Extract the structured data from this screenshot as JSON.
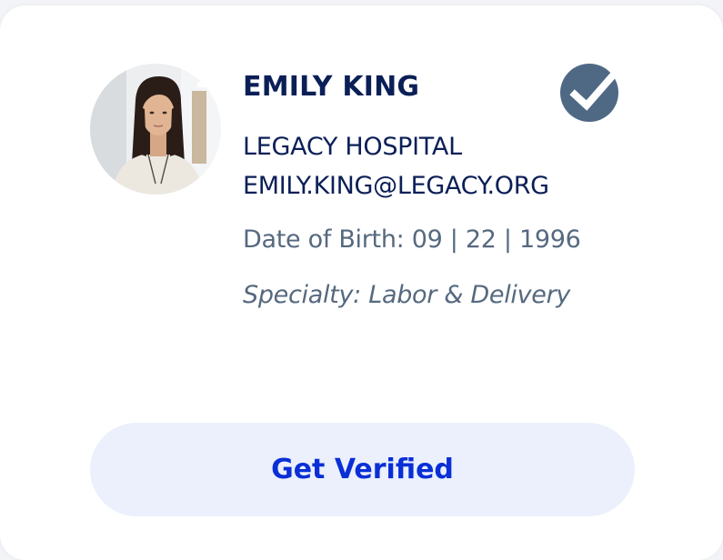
{
  "profile": {
    "name": "EMILY KING",
    "organization": "LEGACY HOSPITAL",
    "email": "EMILY.KING@LEGACY.ORG",
    "date_of_birth": "Date of Birth: 09 | 22 | 1996",
    "specialty": "Specialty: Labor & Delivery",
    "avatar_icon": "person-photo",
    "badge_icon": "verified-checkmark-icon"
  },
  "actions": {
    "get_verified_label": "Get Verified"
  },
  "colors": {
    "name_text": "#0b1f57",
    "secondary_text": "#56697f",
    "badge": "#4f6985",
    "button_bg": "#ebf0fc",
    "button_text": "#0a2fd6"
  }
}
